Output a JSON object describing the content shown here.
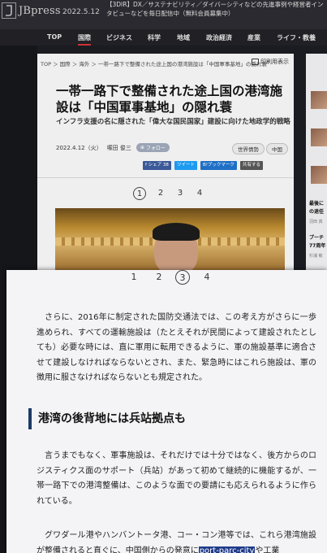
{
  "header": {
    "logo_text": "JBpress",
    "date": "2022.5.12",
    "promo": "【3DIR】DX／サステナビリティ／ダイバーシティなどの先進事例や経営者インタビューなどを毎日配信中（無料会員募集中）"
  },
  "nav": {
    "items": [
      "TOP",
      "国際",
      "ビジネス",
      "科学",
      "地域",
      "政治経済",
      "産業",
      "ライフ・教養"
    ],
    "active_index": 1
  },
  "article": {
    "breadcrumb": "TOP ＞ 国際 ＞ 海外 ＞ 一帯一路下で整備された途上国の港湾施設は「中国軍事基地」の隠れ蓑",
    "print_label": "印刷用表示",
    "title": "一帯一路下で整備された途上国の港湾施設は「中国軍事基地」の隠れ蓑",
    "subtitle": "インフラ支援の名に隠された「偉大な国民国家」建設に向けた地政学的戦略",
    "date": "2022.4.12（火）",
    "author": "塚田 俊三",
    "follow_label": "フォロー",
    "tags": [
      "世界情勢",
      "中国"
    ],
    "shares": [
      "f シェア 38",
      "ツイート",
      "B!ブックマーク",
      "共有する"
    ],
    "pages": [
      "1",
      "2",
      "3",
      "4"
    ],
    "current_page_index": 0
  },
  "rail": {
    "items": [
      {
        "text": "",
        "sub": ""
      },
      {
        "text": "",
        "sub": ""
      },
      {
        "text": "",
        "sub": ""
      },
      {
        "text": "最後に",
        "sub": ""
      },
      {
        "text": "の退任",
        "sub": "羽田 真"
      },
      {
        "text": "プーチ",
        "sub": ""
      },
      {
        "text": "77周年",
        "sub": "杉浦 敏"
      }
    ]
  },
  "magnified": {
    "pages": [
      "1",
      "2",
      "3",
      "4"
    ],
    "current_page_index": 2,
    "para1": "さらに、2016年に制定された国防交通法では、この考え方がさらに一歩進められ、すべての運輸施設は（たとえそれが民間によって建設されたとしても）必要な時には、直に軍用に転用できるように、軍の施設基準に適合させて建設しなければならないとされ、また、緊急時にはこれら施設は、軍の徴用に服さなければならないとも規定された。",
    "heading": "港湾の後背地には兵站拠点も",
    "para2": "言うまでもなく、軍事施設は、それだけでは十分ではなく、後方からのロジスティクス面のサポート（兵站）があって初めて継続的に機能するが、一帯一路下での港湾整備は、このような面での要請にも応えられるように作られている。",
    "para3_a": "グワダール港やハンバントータ港、コー・コン港等では、これら港湾施設が整備されると直ぐに、中国側からの発意に",
    "para3_b": "port-parc-city",
    "para3_c": "や工業"
  }
}
